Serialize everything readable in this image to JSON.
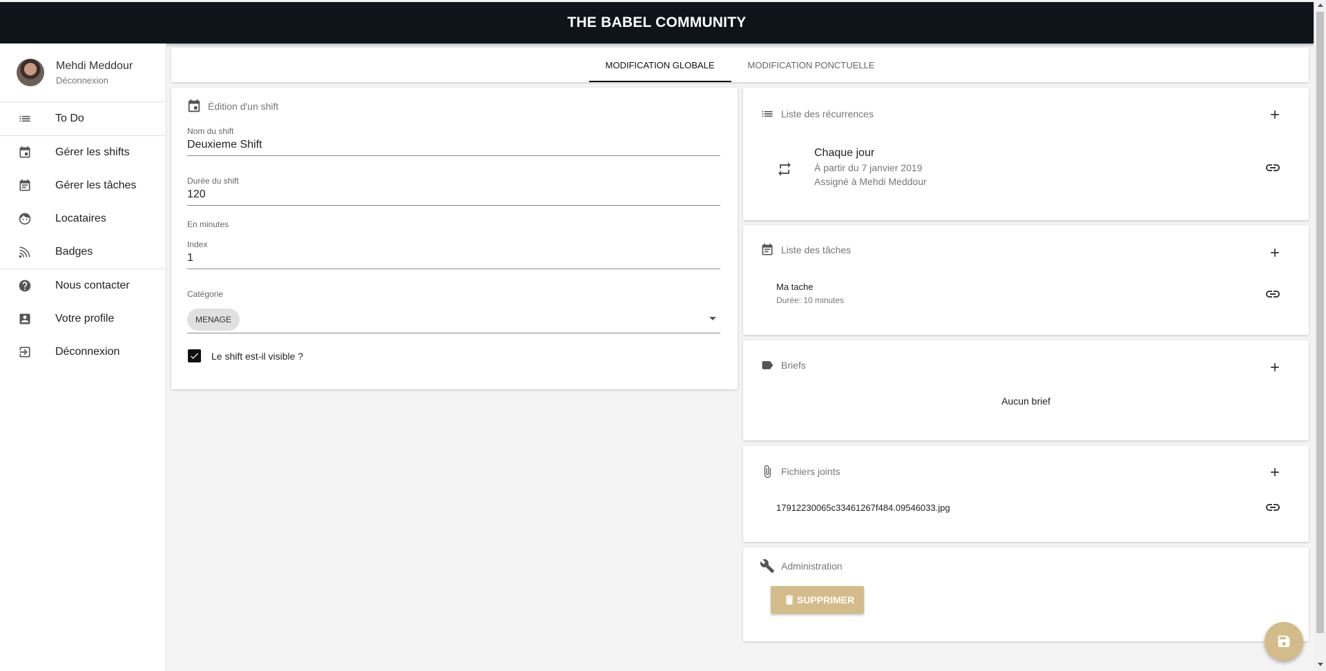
{
  "header": {
    "title": "THE BABEL COMMUNITY"
  },
  "user": {
    "name": "Mehdi Meddour",
    "logout": "Déconnexion"
  },
  "sidebar": {
    "items": [
      {
        "label": "To Do",
        "icon": "list-icon"
      },
      {
        "label": "Gérer les shifts",
        "icon": "calendar-icon"
      },
      {
        "label": "Gérer les tâches",
        "icon": "calendar-note-icon"
      },
      {
        "label": "Locataires",
        "icon": "face-icon"
      },
      {
        "label": "Badges",
        "icon": "nfc-icon"
      },
      {
        "label": "Nous contacter",
        "icon": "help-circle-icon"
      },
      {
        "label": "Votre profile",
        "icon": "account-box-icon"
      },
      {
        "label": "Déconnexion",
        "icon": "exit-icon"
      }
    ]
  },
  "tabs": [
    {
      "label": "MODIFICATION GLOBALE",
      "active": true
    },
    {
      "label": "MODIFICATION PONCTUELLE",
      "active": false
    }
  ],
  "edit": {
    "title": "Édition d'un shift",
    "name_label": "Nom du shift",
    "name_value": "Deuxieme Shift",
    "duration_label": "Durée du shift",
    "duration_value": "120",
    "duration_hint": "En minutes",
    "index_label": "Index",
    "index_value": "1",
    "category_label": "Catégorie",
    "category_chip": "MENAGE",
    "visible_label": "Le shift est-il visible ?",
    "visible_checked": true
  },
  "recurrences": {
    "title": "Liste des récurrences",
    "item": {
      "title": "Chaque jour",
      "start": "À partir du 7 janvier 2019",
      "assigned": "Assigné à Mehdi Meddour"
    }
  },
  "tasks": {
    "title": "Liste des tâches",
    "item": {
      "name": "Ma tache",
      "duration": "Durée: 10 minutes"
    }
  },
  "briefs": {
    "title": "Briefs",
    "empty": "Aucun brief"
  },
  "files": {
    "title": "Fichiers joints",
    "item": "17912230065c33461267f484.09546033.jpg"
  },
  "admin": {
    "title": "Administration",
    "delete_label": "SUPPRIMER"
  },
  "colors": {
    "accent": "#d4bc8a",
    "header": "#0f141b"
  }
}
